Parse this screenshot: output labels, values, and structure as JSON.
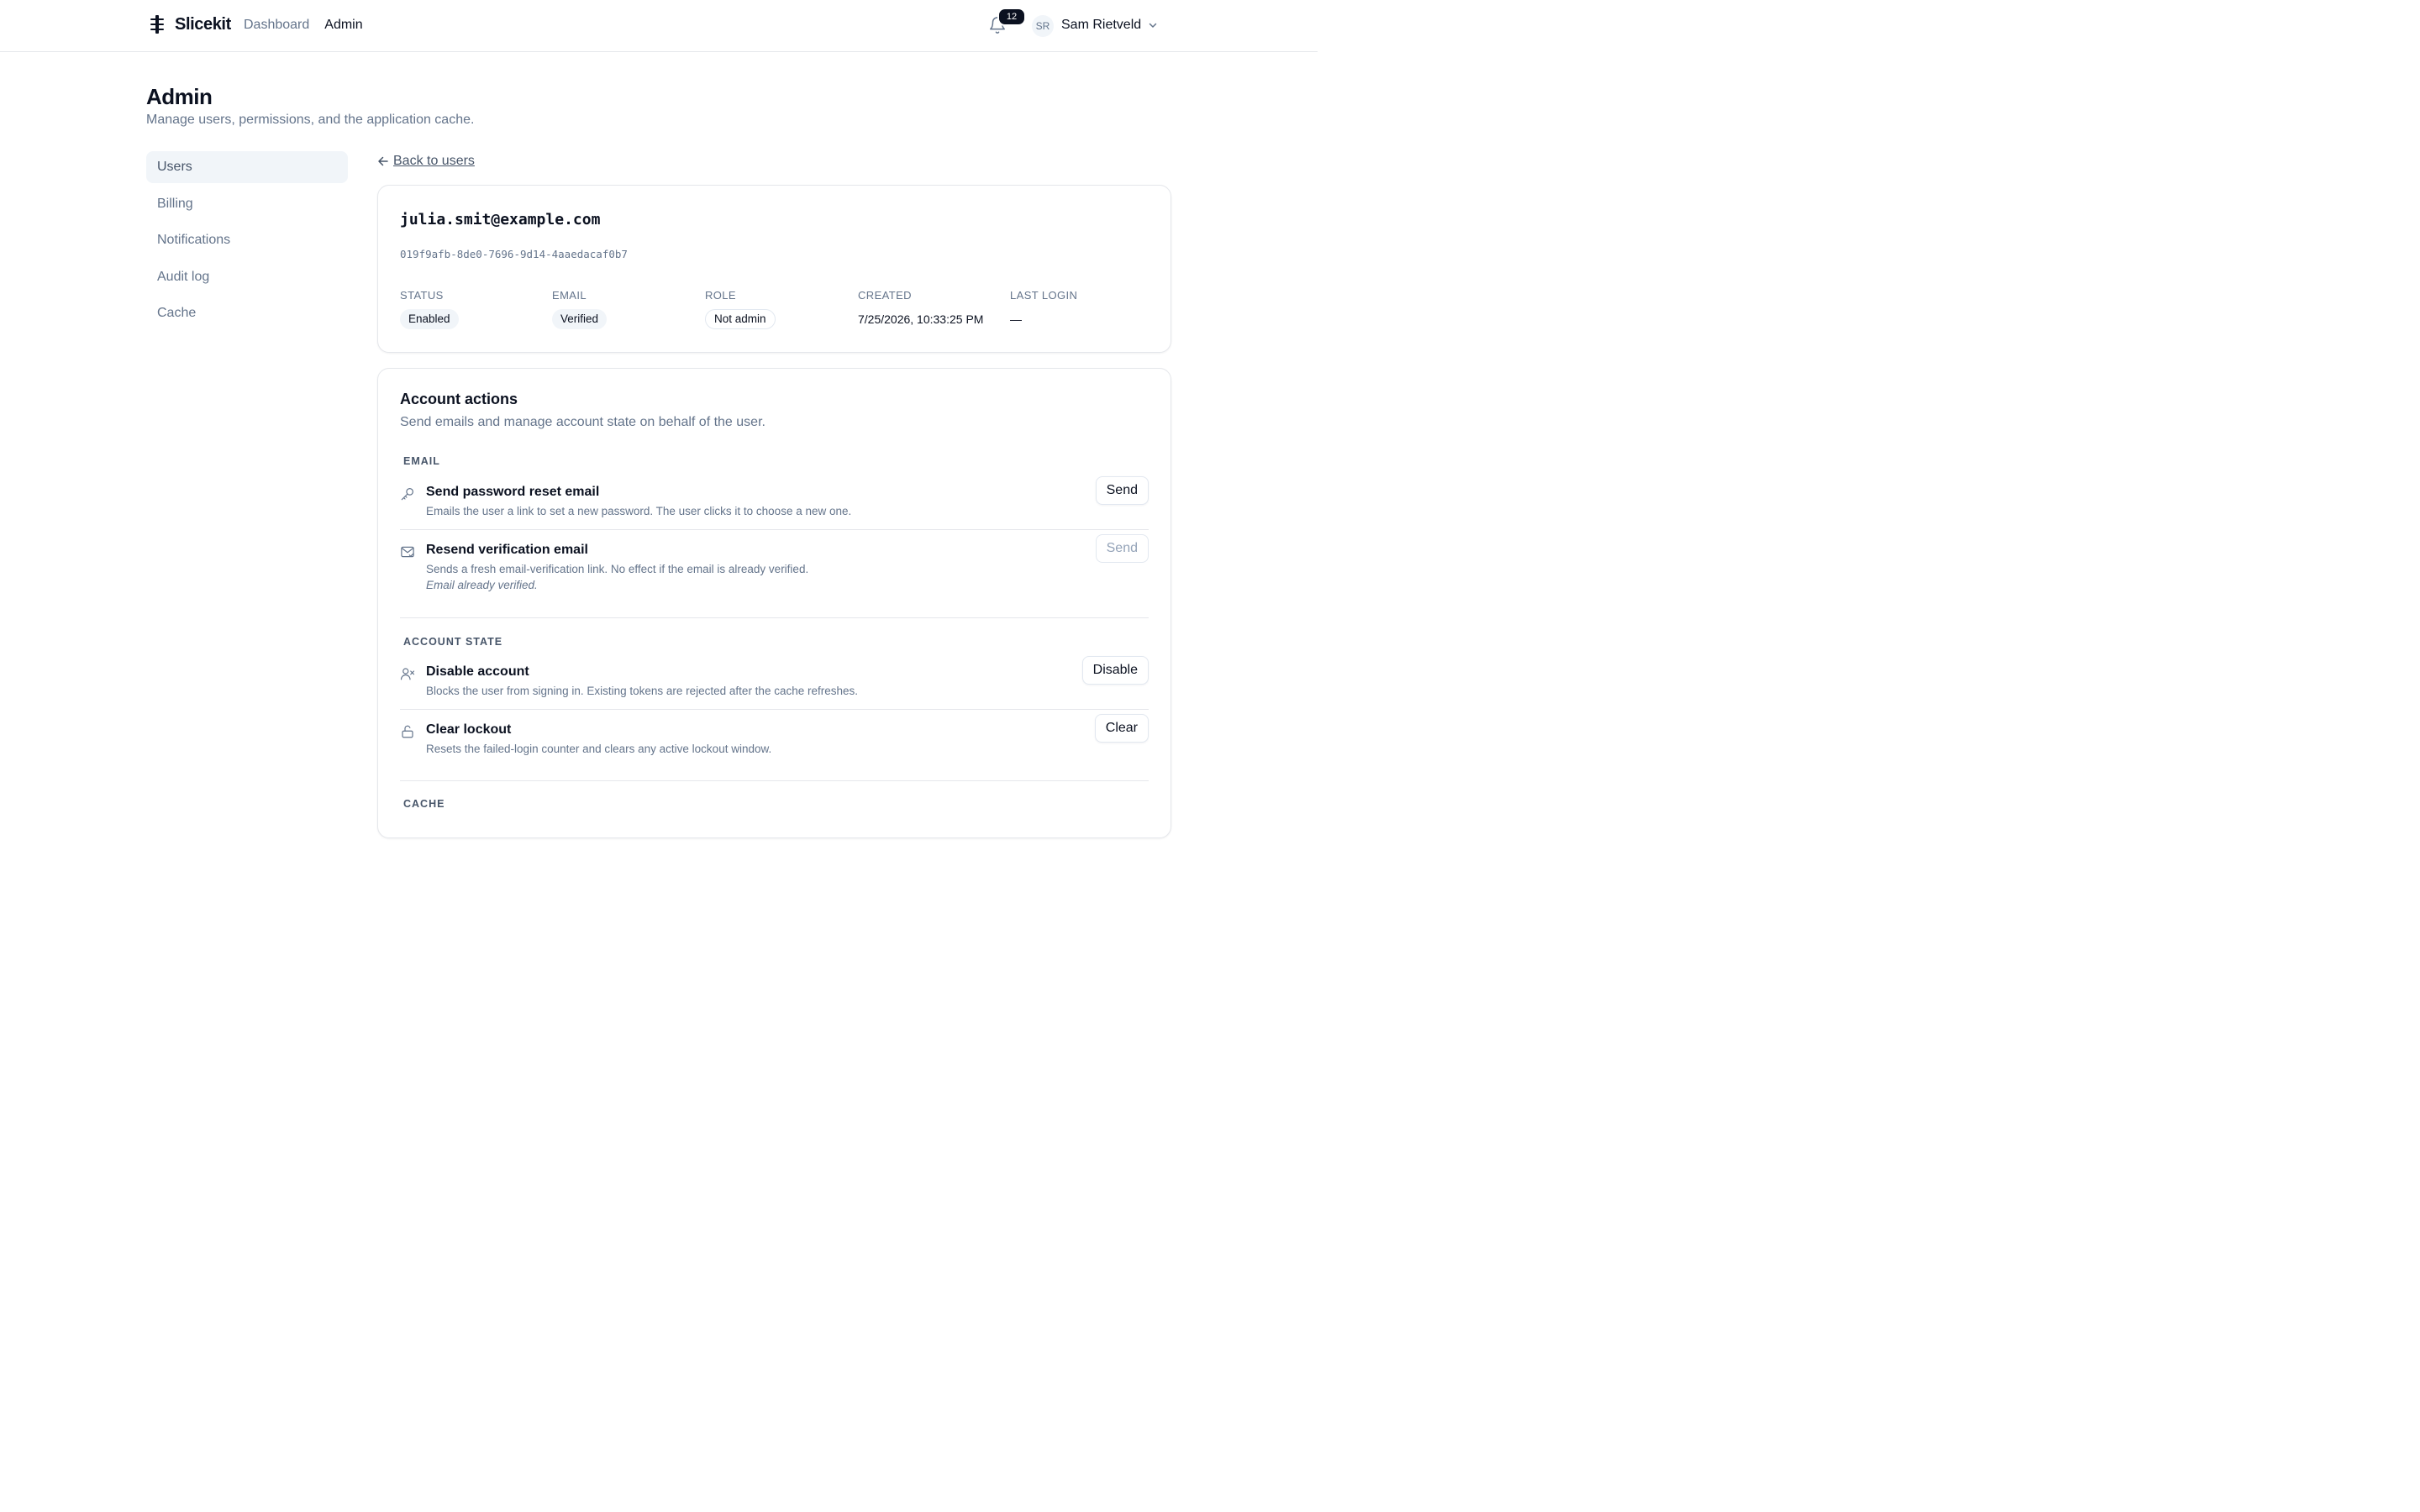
{
  "header": {
    "brand": "Slicekit",
    "nav": [
      {
        "label": "Dashboard",
        "active": false
      },
      {
        "label": "Admin",
        "active": true
      }
    ],
    "notifications_count": "12",
    "user_initials": "SR",
    "user_name": "Sam Rietveld"
  },
  "page": {
    "title": "Admin",
    "subtitle": "Manage users, permissions, and the application cache."
  },
  "sidebar": {
    "items": [
      {
        "label": "Users",
        "active": true
      },
      {
        "label": "Billing",
        "active": false
      },
      {
        "label": "Notifications",
        "active": false
      },
      {
        "label": "Audit log",
        "active": false
      },
      {
        "label": "Cache",
        "active": false
      }
    ]
  },
  "back_link": "Back to users",
  "user": {
    "email": "julia.smit@example.com",
    "id": "019f9afb-8de0-7696-9d14-4aaedacaf0b7",
    "meta": [
      {
        "label": "STATUS",
        "value": "Enabled"
      },
      {
        "label": "EMAIL",
        "value": "Verified"
      },
      {
        "label": "ROLE",
        "value": "Not admin"
      },
      {
        "label": "CREATED",
        "value": "7/25/2026, 10:33:25 PM"
      },
      {
        "label": "LAST LOGIN",
        "value": "—"
      }
    ]
  },
  "account_actions": {
    "title": "Account actions",
    "subtitle": "Send emails and manage account state on behalf of the user.",
    "groups": [
      {
        "label": "EMAIL",
        "actions": [
          {
            "title": "Send password reset email",
            "description": "Emails the user a link to set a new password. The user clicks it to choose a new one.",
            "note": "",
            "button": "Send",
            "enabled": true,
            "icon": "key-icon"
          },
          {
            "title": "Resend verification email",
            "description": "Sends a fresh email-verification link. No effect if the email is already verified.",
            "note": "Email already verified.",
            "button": "Send",
            "enabled": false,
            "icon": "mail-check-icon"
          }
        ]
      },
      {
        "label": "ACCOUNT STATE",
        "actions": [
          {
            "title": "Disable account",
            "description": "Blocks the user from signing in. Existing tokens are rejected after the cache refreshes.",
            "note": "",
            "button": "Disable",
            "enabled": true,
            "icon": "user-x-icon"
          },
          {
            "title": "Clear lockout",
            "description": "Resets the failed-login counter and clears any active lockout window.",
            "note": "",
            "button": "Clear",
            "enabled": true,
            "icon": "unlock-icon"
          }
        ]
      },
      {
        "label": "CACHE",
        "actions": []
      }
    ]
  }
}
